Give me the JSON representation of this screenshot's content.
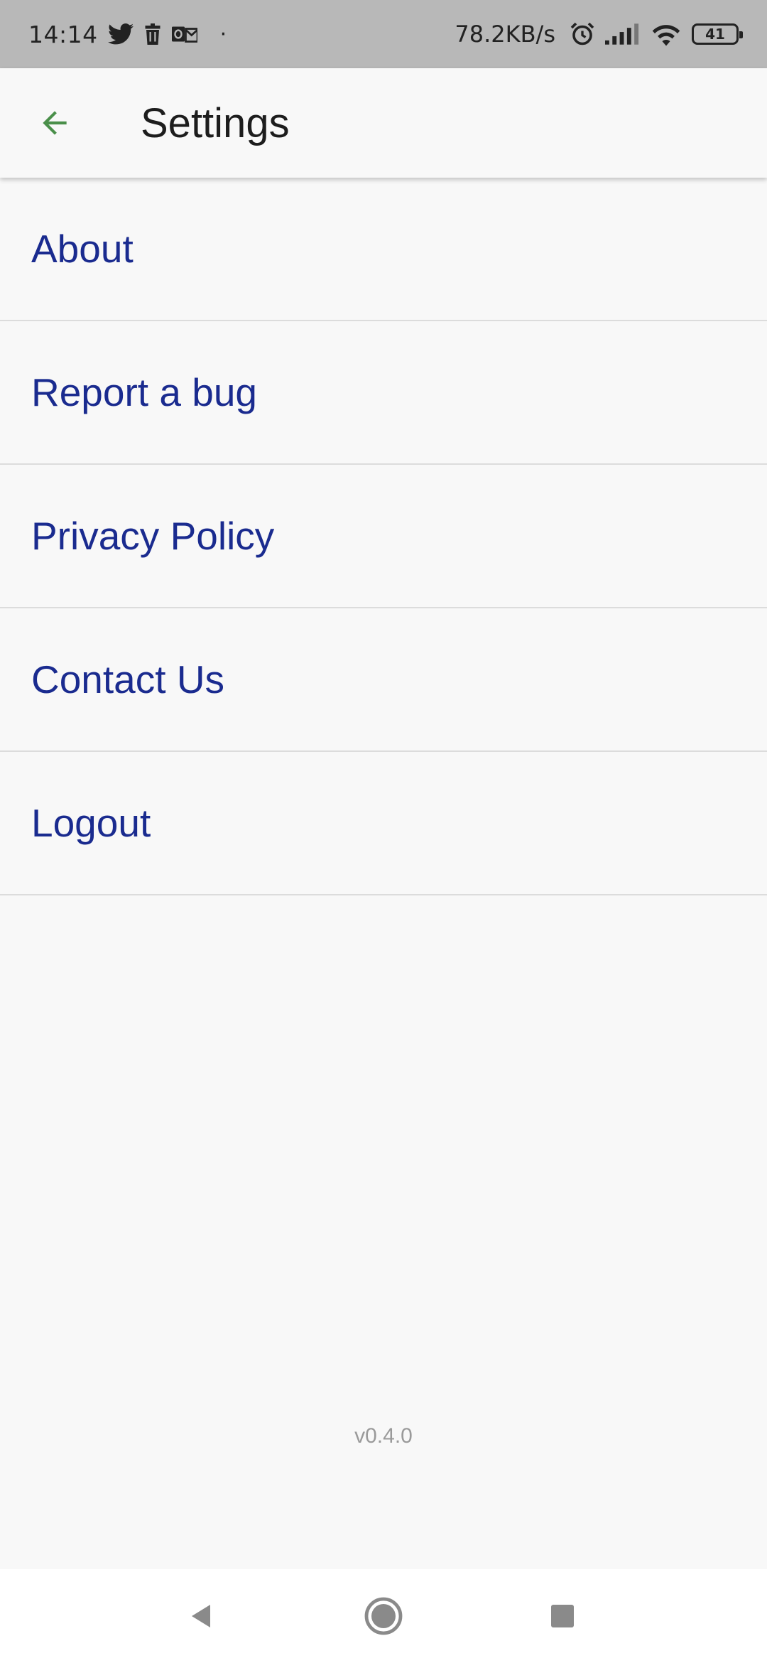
{
  "status_bar": {
    "time": "14:14",
    "net_speed": "78.2KB/s",
    "battery": "41",
    "notification_icons": [
      "twitter-icon",
      "trash-icon",
      "outlook-icon"
    ],
    "system_icons": [
      "alarm-icon",
      "signal-icon",
      "wifi-icon",
      "battery-icon"
    ]
  },
  "app_bar": {
    "back_icon": "arrow-left-icon",
    "title": "Settings"
  },
  "settings": {
    "items": [
      {
        "label": "About"
      },
      {
        "label": "Report a bug"
      },
      {
        "label": "Privacy Policy"
      },
      {
        "label": "Contact Us"
      },
      {
        "label": "Logout"
      }
    ]
  },
  "version": "v0.4.0",
  "nav_bar": {
    "icons": [
      "nav-back-icon",
      "nav-home-icon",
      "nav-recents-icon"
    ]
  },
  "colors": {
    "accent_green": "#4a8f4a",
    "item_text": "#1a2b8f",
    "status_bar_bg": "#b8b8b8",
    "page_bg": "#f8f8f8"
  }
}
